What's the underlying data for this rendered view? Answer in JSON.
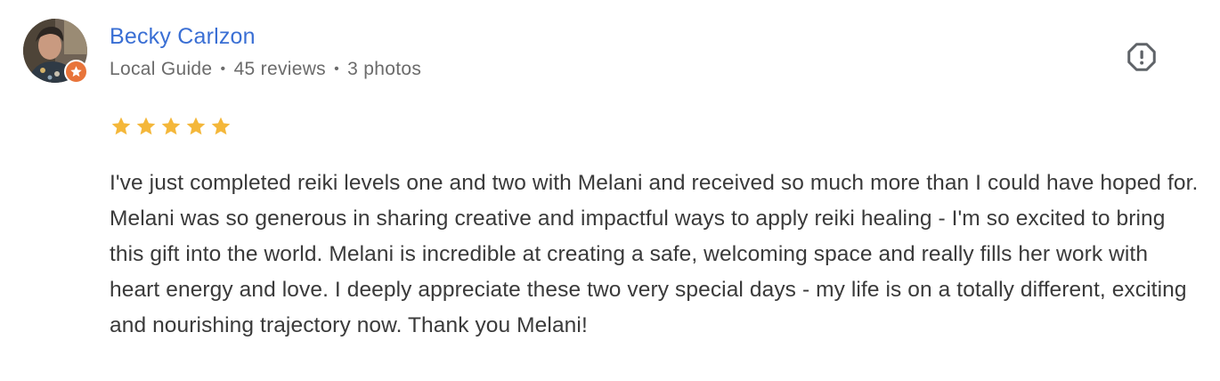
{
  "reviewer": {
    "name": "Becky Carlzon",
    "badge": "Local Guide",
    "separator": "•",
    "reviews": "45 reviews",
    "photos": "3 photos"
  },
  "rating": {
    "stars": 5,
    "max": 5,
    "star_color": "#f4b73a"
  },
  "review": {
    "text": "I've just completed reiki levels one and two with Melani and received so much more than I could have hoped for. Melani was so generous in sharing creative and impactful ways to apply reiki healing - I'm so excited to bring this gift into the world. Melani is incredible at creating a safe, welcoming space and really fills her work with heart energy and love. I deeply appreciate these two very special days - my life is on a totally different, exciting and nourishing trajectory now. Thank you Melani!"
  },
  "icons": {
    "report": "report-flag-icon",
    "local_guide": "local-guide-star-icon"
  },
  "colors": {
    "name": "#3a6fd4",
    "meta": "#6b6b6b",
    "text": "#3a3a3a",
    "badge": "#e8743a"
  }
}
